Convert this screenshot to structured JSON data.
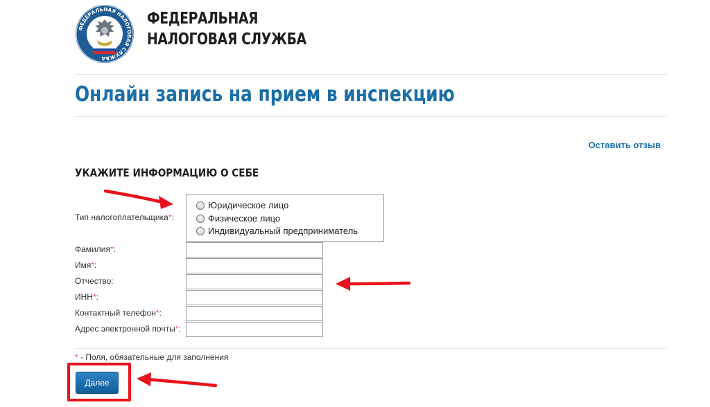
{
  "header": {
    "org_name_line1": "ФЕДЕРАЛЬНАЯ",
    "org_name_line2": "НАЛОГОВАЯ СЛУЖБА",
    "logo_icon": "fns-emblem-icon",
    "logo_text": "ФЕДЕРАЛЬНАЯ НАЛОГОВАЯ СЛУЖБА"
  },
  "page_title": "Онлайн запись на прием в инспекцию",
  "feedback_link": "Оставить отзыв",
  "form": {
    "section_title": "УКАЖИТЕ ИНФОРМАЦИЮ О СЕБЕ",
    "taxpayer_type": {
      "label": "Тип налогоплательщика",
      "required_mark": "*",
      "label_suffix": ":",
      "options": [
        "Юридическое лицо",
        "Физическое лицо",
        "Индивидуальный предприниматель"
      ]
    },
    "fields": [
      {
        "label": "Фамилия",
        "required_mark": "*",
        "suffix": ":",
        "value": ""
      },
      {
        "label": "Имя",
        "required_mark": "*",
        "suffix": ":",
        "value": ""
      },
      {
        "label": "Отчество:",
        "required_mark": "",
        "suffix": "",
        "value": ""
      },
      {
        "label": "ИНН",
        "required_mark": "*",
        "suffix": ":",
        "value": ""
      },
      {
        "label": "Контактный телефон",
        "required_mark": "*",
        "suffix": ":",
        "value": ""
      },
      {
        "label": "Адрес электронной почты",
        "required_mark": "*",
        "suffix": ":",
        "value": ""
      }
    ],
    "required_note_mark": "*",
    "required_note": " - Поля, обязательные для заполнения",
    "next_button": "Далее"
  },
  "colors": {
    "accent_blue": "#1a6fa9",
    "required_red": "#d9534f",
    "annotation_red": "#e8121b"
  }
}
